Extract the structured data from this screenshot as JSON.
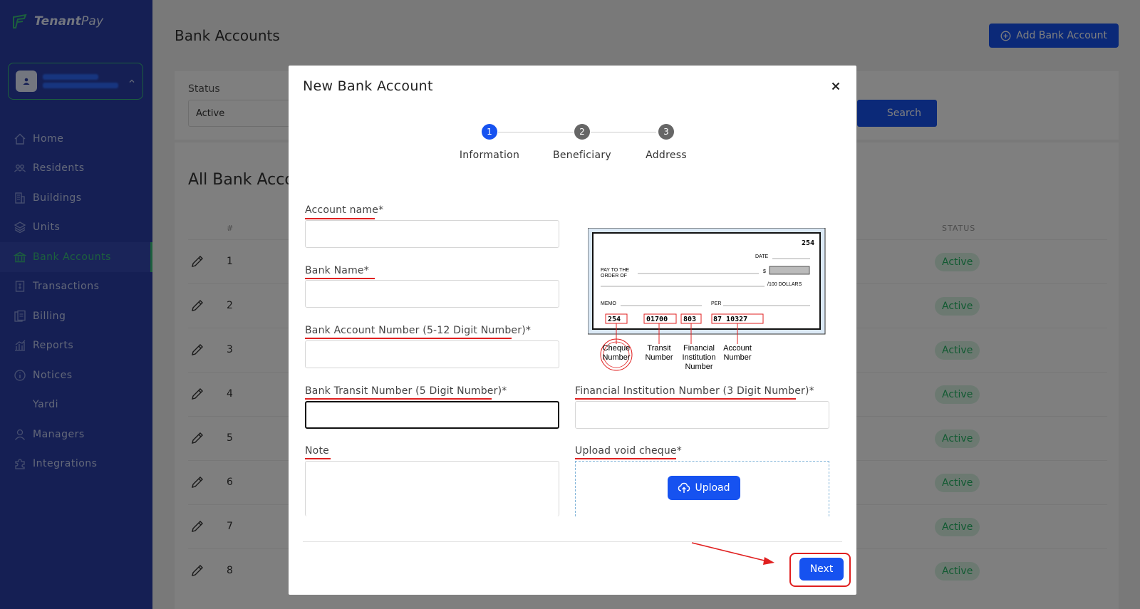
{
  "brand": {
    "name_bold": "Tenant",
    "name_light": "Pay"
  },
  "sidebar": {
    "items": [
      {
        "label": "Home",
        "icon": "home-icon",
        "active": false
      },
      {
        "label": "Residents",
        "icon": "people-icon",
        "active": false
      },
      {
        "label": "Buildings",
        "icon": "building-icon",
        "active": false
      },
      {
        "label": "Units",
        "icon": "layers-icon",
        "active": false
      },
      {
        "label": "Bank Accounts",
        "icon": "bank-icon",
        "active": true
      },
      {
        "label": "Transactions",
        "icon": "receipt-icon",
        "active": false
      },
      {
        "label": "Billing",
        "icon": "billing-icon",
        "active": false
      },
      {
        "label": "Reports",
        "icon": "chart-icon",
        "active": false
      },
      {
        "label": "Notices",
        "icon": "info-icon",
        "active": false
      },
      {
        "label": "Yardi",
        "icon": "",
        "active": false
      },
      {
        "label": "Managers",
        "icon": "user-icon",
        "active": false
      },
      {
        "label": "Integrations",
        "icon": "puzzle-icon",
        "active": false
      }
    ]
  },
  "page": {
    "title": "Bank Accounts",
    "add_button": "Add Bank Account",
    "filter": {
      "status_label": "Status",
      "status_value": "Active",
      "search_button": "Search"
    },
    "table": {
      "title": "All Bank Accounts",
      "col_num": "#",
      "col_status": "STATUS",
      "rows": [
        {
          "num": "1",
          "status": "Active"
        },
        {
          "num": "2",
          "status": "Active"
        },
        {
          "num": "3",
          "status": "Active"
        },
        {
          "num": "4",
          "status": "Active"
        },
        {
          "num": "5",
          "status": "Active"
        },
        {
          "num": "6",
          "status": "Active"
        },
        {
          "num": "7",
          "status": "Active"
        },
        {
          "num": "8",
          "status": "Active"
        }
      ]
    }
  },
  "modal": {
    "title": "New Bank Account",
    "steps": [
      {
        "num": "1",
        "label": "Information",
        "active": true
      },
      {
        "num": "2",
        "label": "Beneficiary",
        "active": false
      },
      {
        "num": "3",
        "label": "Address",
        "active": false
      }
    ],
    "fields": {
      "account_name": "Account name*",
      "bank_name": "Bank Name*",
      "account_number": "Bank Account Number (5-12 Digit Number)*",
      "transit_number": "Bank Transit Number (5 Digit Number)*",
      "institution_number": "Financial Institution Number (3 Digit Number)*",
      "note": "Note",
      "upload_label": "Upload void cheque*"
    },
    "upload_button": "Upload",
    "next_button": "Next",
    "cheque": {
      "number": "254",
      "date": "DATE",
      "pay_to": "PAY TO THE",
      "order_of": "ORDER OF",
      "dollar_sign": "$",
      "dollars": "/100 DOLLARS",
      "memo": "MEMO",
      "per": "PER",
      "micr_cheque": "254",
      "micr_transit": "01700",
      "micr_institution": "803",
      "micr_account": "87 10327",
      "legend_cheque_1": "Cheque",
      "legend_cheque_2": "Number",
      "legend_transit_1": "Transit",
      "legend_transit_2": "Number",
      "legend_inst_1": "Financial",
      "legend_inst_2": "Institution",
      "legend_inst_3": "Number",
      "legend_account_1": "Account",
      "legend_account_2": "Number"
    }
  },
  "colors": {
    "sidebar": "#2a3fa8",
    "accent": "#1652f0",
    "active_green": "#39c07b",
    "annotation_red": "#e02020"
  }
}
